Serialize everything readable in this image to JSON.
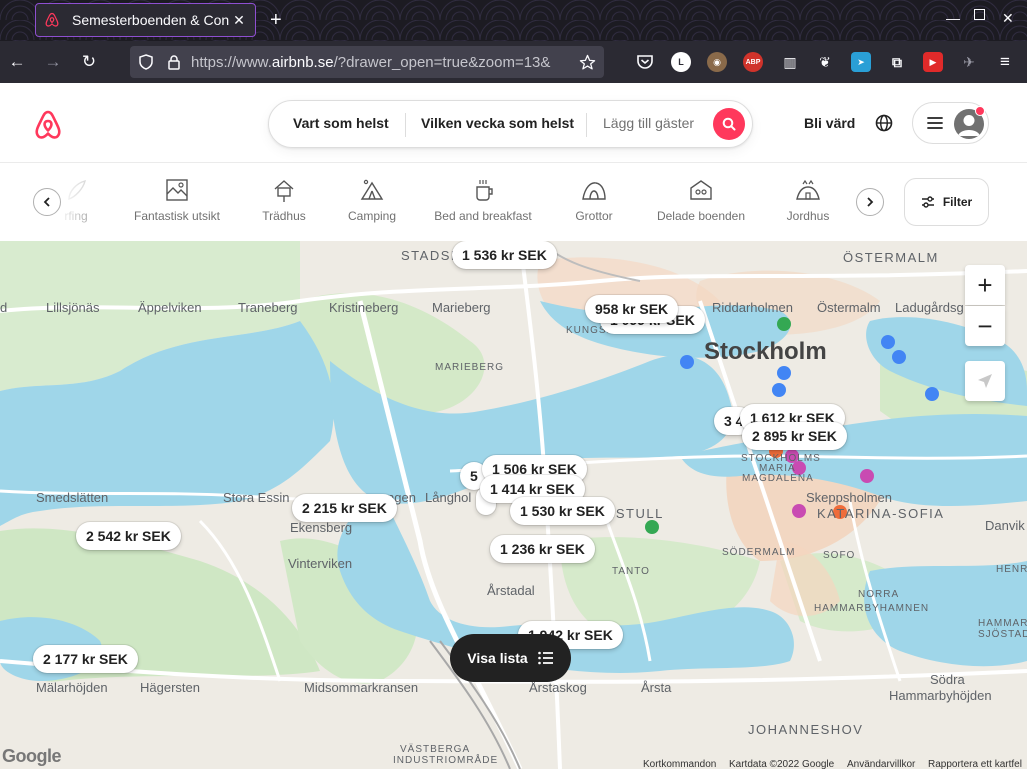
{
  "browser": {
    "tab_title": "Semesterboenden & Con",
    "url_prefix": "https://www.",
    "url_domain": "airbnb.se",
    "url_rest": "/?drawer_open=true&zoom=13&",
    "ext_l": "L",
    "ext_abp": "ABP"
  },
  "header": {
    "search_location": "Vart som helst",
    "search_week": "Vilken vecka som helst",
    "search_guests": "Lägg till gäster",
    "host_label": "Bli värd"
  },
  "categories": {
    "items": [
      {
        "label": "rfing"
      },
      {
        "label": "Fantastisk utsikt"
      },
      {
        "label": "Trädhus"
      },
      {
        "label": "Camping"
      },
      {
        "label": "Bed and breakfast"
      },
      {
        "label": "Grottor"
      },
      {
        "label": "Delade boenden"
      },
      {
        "label": "Jordhus"
      }
    ],
    "filter_label": "Filter"
  },
  "map": {
    "labels": {
      "stadshagen": "STADSH",
      "ostermalm_caps": "ÖSTERMALM",
      "lillsjonas": "Lillsjönäs",
      "appelviken": "Äppelviken",
      "traneberg": "Traneberg",
      "kristineberg": "Kristineberg",
      "marieberg": "Marieberg",
      "riddarholmen": "Riddarholmen",
      "ostermalm": "Östermalm",
      "ladugardsg": "Ladugårdsg",
      "kungsh": "KUNGSH",
      "stockholm": "Stockholm",
      "marieberg_small": "MARIEBERG",
      "stockholms": "STOCKHOLMS",
      "maria": "MARIA",
      "magdalena": "MAGDALENA",
      "smedslatten": "Smedslätten",
      "stora_essingen": "Stora Essin",
      "essingen_rest": "ngen",
      "langhol": "Långhol",
      "skeppsholmen": "Skeppsholmen",
      "katarina_sofia": "KATARINA-SOFIA",
      "danviks": "Danvik",
      "ekensberg": "Ekensberg",
      "hornstull": "NSTULL",
      "tanto": "TANTO",
      "sodermalm": "SÖDERMALM",
      "sofo": "SOFO",
      "henr": "HENR",
      "vinterviken": "Vinterviken",
      "norra": "NORRA",
      "hammarbyhamnen": "HAMMARBYHAMNEN",
      "arstadal": "Årstadal",
      "hammarby_sj": "HAMMARBY",
      "sjostad": "SJÖSTAD",
      "malarhojden": "Mälarhöjden",
      "hagersten": "Hägersten",
      "midsommarkransen": "Midsommarkransen",
      "arstaskog": "Årstaskog",
      "arsta": "Årsta",
      "sodra": "Södra",
      "hammarbyhojden": "Hammarbyhöjden",
      "johanneshov": "JOHANNESHOV",
      "vastberga": "VÄSTBERGA",
      "industriomrade": "INDUSTRIOMRÅDE",
      "d_left": "d"
    },
    "prices": [
      "1 536 kr SEK",
      "958 kr SEK",
      "1 099 kr SEK",
      "3 4",
      "1 612 kr SEK",
      "2 895 kr SEK",
      "5",
      "1 506 kr SEK",
      "1 414 kr SEK",
      "1 530 kr SEK",
      "2 215 kr SEK",
      "2 542 kr SEK",
      "1 236 kr SEK",
      "1 942 kr SEK",
      "2 177 kr SEK"
    ],
    "visa_lista": "Visa lista",
    "zoom_in": "+",
    "zoom_out": "−",
    "google": "Google",
    "footer": {
      "shortcuts": "Kortkommandon",
      "mapdata": "Kartdata ©2022 Google",
      "terms": "Användarvillkor",
      "report": "Rapportera ett kartfel"
    }
  },
  "colors": {
    "brand": "#ff385c",
    "water": "#9fd6e9",
    "park": "#cde8c2",
    "land": "#eeebe4"
  }
}
